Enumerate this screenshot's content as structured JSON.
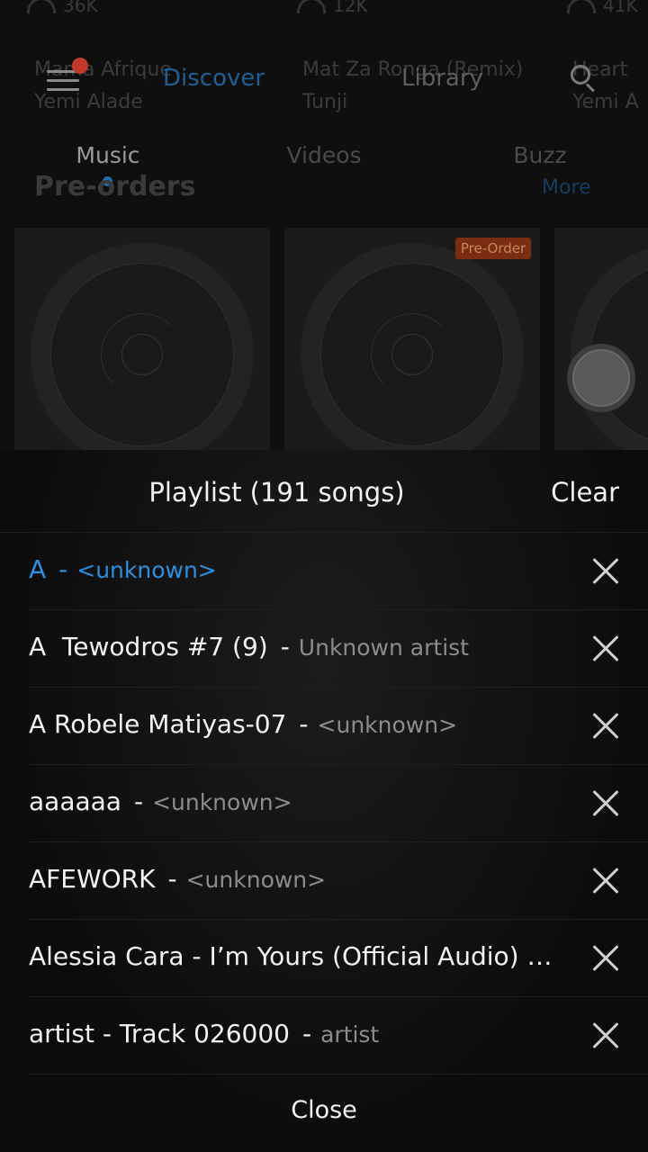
{
  "background": {
    "plays": [
      "36K",
      "12K",
      "41K"
    ],
    "songs": [
      {
        "title": "Mama Afrique",
        "artist": "Yemi Alade"
      },
      {
        "title": "Mat Za Ronga (Remix)",
        "artist": "Tunji"
      },
      {
        "title": "Heart",
        "artist": "Yemi A"
      }
    ],
    "header": {
      "discover": "Discover",
      "library": "Library"
    },
    "subtabs": [
      "Music",
      "Videos",
      "Buzz"
    ],
    "section_title": "Pre-orders",
    "section_more": "More",
    "badge": "Pre-Order"
  },
  "playlist": {
    "title": "Playlist (191 songs)",
    "clear_label": "Clear",
    "separator": "-",
    "tracks": [
      {
        "title": "A",
        "artist": "<unknown>",
        "current": true
      },
      {
        "title": "A  Tewodros #7 (9)",
        "artist": "Unknown artist"
      },
      {
        "title": "A Robele Matiyas-07",
        "artist": "<unknown>"
      },
      {
        "title": "aaaaaa",
        "artist": "<unknown>"
      },
      {
        "title": "AFEWORK",
        "artist": "<unknown>"
      },
      {
        "title": "Alessia Cara - I’m Yours (Official Audio) …",
        "artist": ""
      },
      {
        "title": "artist - Track 026000",
        "artist": "artist"
      }
    ],
    "close_label": "Close"
  },
  "colors": {
    "accent": "#2d8fe0",
    "badge": "#7a2d10",
    "notification_dot": "#c0392b"
  }
}
